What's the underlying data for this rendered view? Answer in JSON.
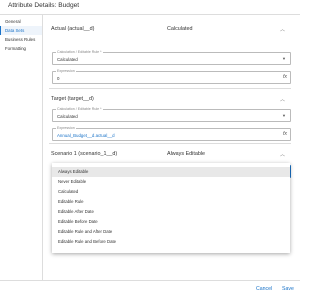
{
  "window": {
    "title": "Attribute Details: Budget"
  },
  "sidebar": {
    "items": [
      {
        "label": "General"
      },
      {
        "label": "Data Sets"
      },
      {
        "label": "Business Rules"
      },
      {
        "label": "Formatting"
      }
    ]
  },
  "sections": {
    "actual": {
      "title": "Actual (actual__d)",
      "status": "Calculated",
      "rule_label": "Calculation / Editable Rule *",
      "rule_value": "Calculated",
      "expr_label": "Expression",
      "expr_value": "0"
    },
    "target": {
      "title": "Target (target__d)",
      "rule_label": "Calculation / Editable Rule *",
      "rule_value": "Calculated",
      "expr_label": "Expression",
      "expr_value": "Annual_Budget__d.actual__d"
    },
    "scenario": {
      "title": "Scenario 1 (scenario_1__d)",
      "status": "Always Editable",
      "rule_label": "Calculation / Editable Rule *",
      "rule_value": "Always Editable"
    }
  },
  "dropdown": {
    "selected": "Always Editable",
    "options": [
      "Always Editable",
      "Never Editable",
      "Calculated",
      "Editable Rule",
      "Editable After Date",
      "Editable Before Date",
      "Editable Rule and After Date",
      "Editable Rule and Before Date"
    ]
  },
  "footer": {
    "cancel_label": "Cancel",
    "save_label": "Save"
  },
  "icons": {
    "collapse": "chevron-up-icon",
    "expand_select": "caret-down-icon",
    "formula": "fx-icon"
  },
  "colors": {
    "accent": "#1a73c8"
  }
}
